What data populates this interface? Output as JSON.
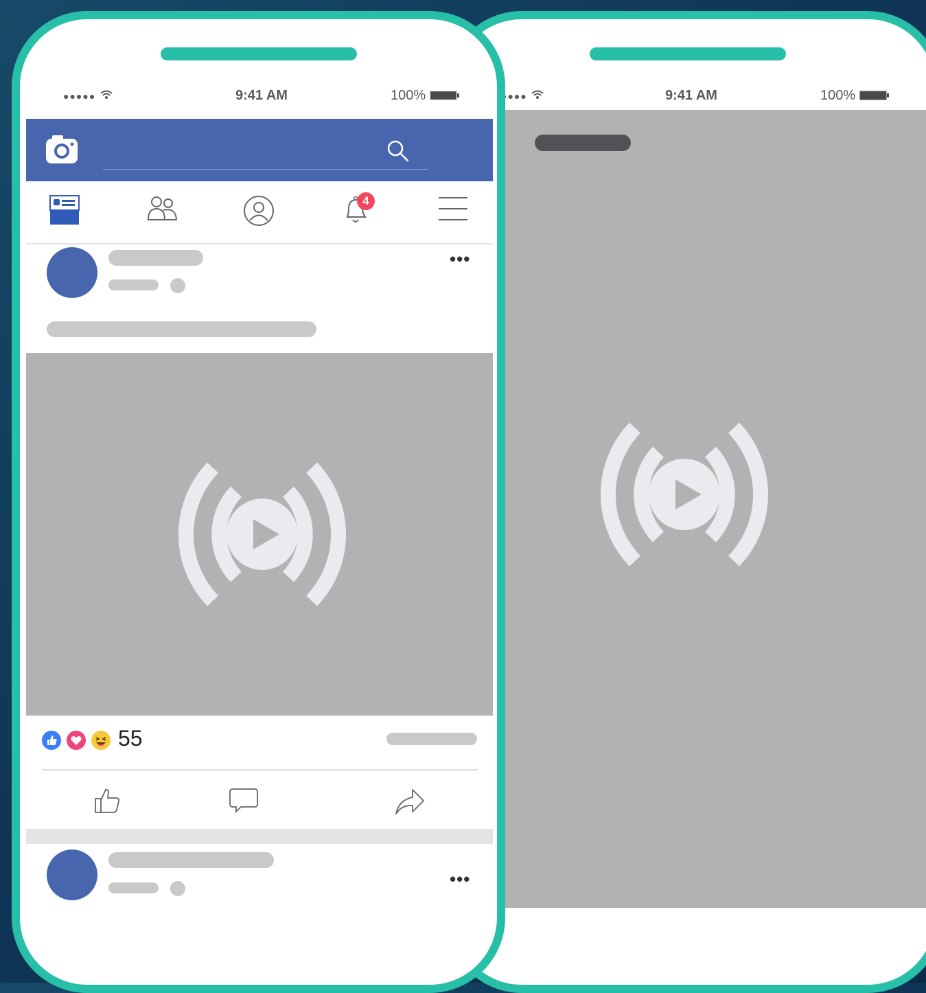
{
  "colors": {
    "frame": "#27bfa7",
    "appbar": "#4766ae",
    "media_placeholder": "#b2b2b2",
    "badge": "#f0475c",
    "avatar_live": "#7b0a12"
  },
  "status_bar": {
    "signal_text": "●●●●●",
    "time": "9:41 AM",
    "battery_percent": "100%"
  },
  "back_phone": {
    "status_bar": {
      "signal_text": "●●●●",
      "time": "9:41 AM",
      "battery_percent": "100%"
    },
    "media_icon": "live-broadcast-play-icon"
  },
  "front_phone": {
    "appbar": {
      "camera_icon": "camera-icon",
      "search_icon": "search-icon"
    },
    "nav": {
      "items": [
        {
          "name": "news-feed",
          "icon": "news-feed-icon",
          "active": true
        },
        {
          "name": "friends",
          "icon": "friends-icon",
          "active": false
        },
        {
          "name": "profile",
          "icon": "profile-icon",
          "active": false
        },
        {
          "name": "notifications",
          "icon": "bell-icon",
          "active": false,
          "badge": "4"
        },
        {
          "name": "menu",
          "icon": "hamburger-menu-icon",
          "active": false
        }
      ]
    },
    "post": {
      "more_label": "•••",
      "media_icon": "live-broadcast-play-icon",
      "reactions": [
        "like-reaction-icon",
        "love-reaction-icon",
        "haha-reaction-icon"
      ],
      "reaction_count": "55",
      "actions": [
        "like-action-icon",
        "comment-action-icon",
        "share-action-icon"
      ]
    },
    "next_post": {
      "more_label": "•••"
    }
  }
}
